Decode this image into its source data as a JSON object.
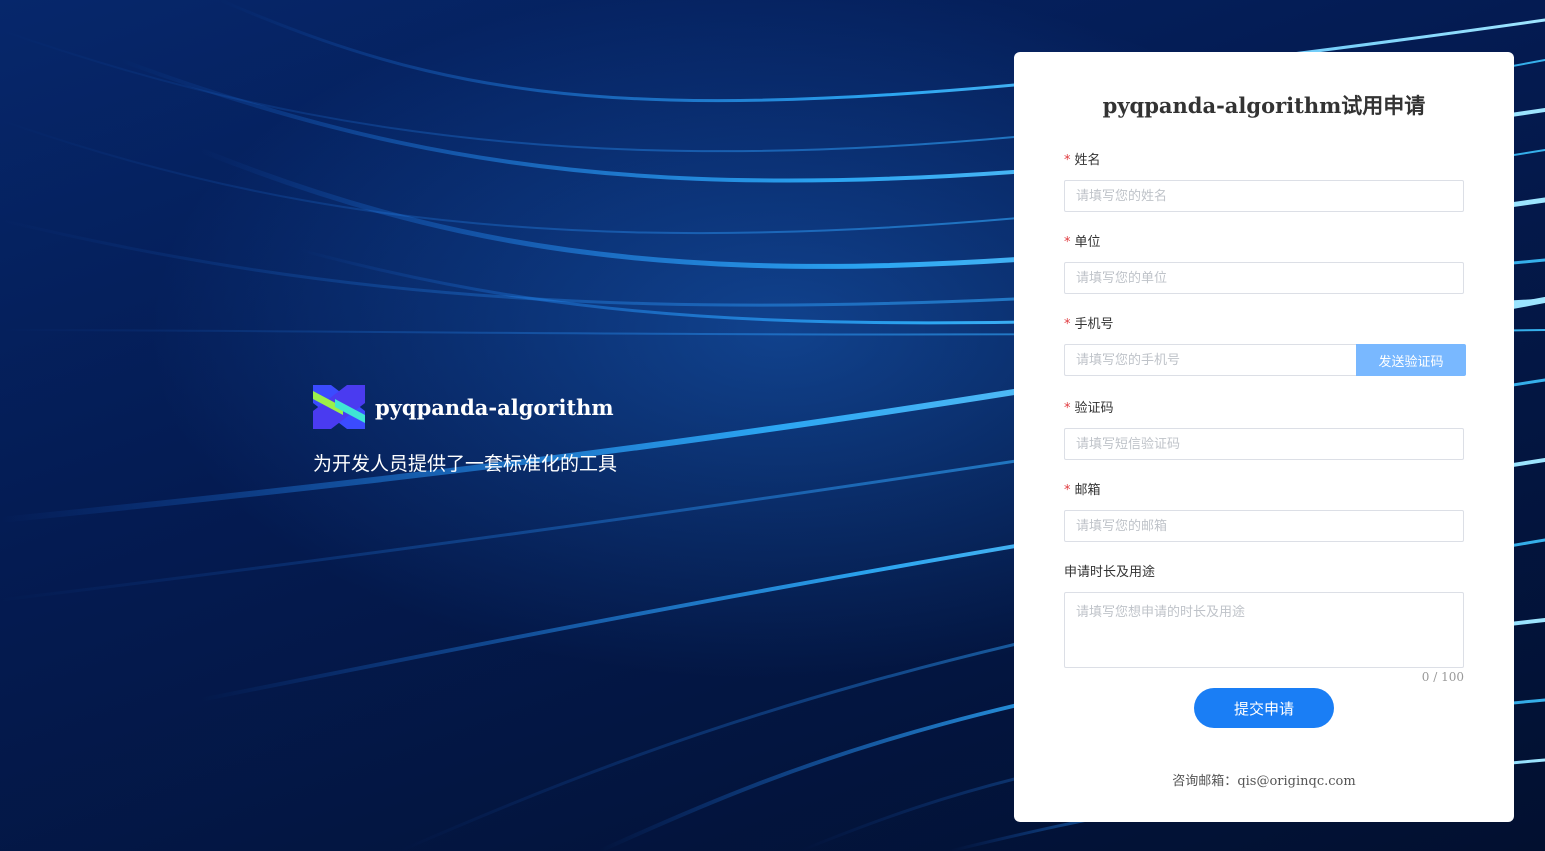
{
  "brand": {
    "name": "pyqpanda-algorithm",
    "tagline": "为开发人员提供了一套标准化的工具"
  },
  "form": {
    "title": "pyqpanda-algorithm试用申请",
    "required_mark": "*",
    "name": {
      "label": "姓名",
      "placeholder": "请填写您的姓名"
    },
    "org": {
      "label": "单位",
      "placeholder": "请填写您的单位"
    },
    "phone": {
      "label": "手机号",
      "placeholder": "请填写您的手机号",
      "send_label": "发送验证码"
    },
    "code": {
      "label": "验证码",
      "placeholder": "请填写短信验证码"
    },
    "email": {
      "label": "邮箱",
      "placeholder": "请填写您的邮箱"
    },
    "purpose": {
      "label": "申请时长及用途",
      "placeholder": "请填写您想申请的时长及用途",
      "counter": "0 / 100"
    },
    "submit_label": "提交申请",
    "contact_prefix": "咨询邮箱：",
    "contact_email": "qis@originqc.com"
  },
  "colors": {
    "accent": "#1a7ef5",
    "send_button": "#79b8ff",
    "required": "#e0393e",
    "background": "#031441"
  }
}
